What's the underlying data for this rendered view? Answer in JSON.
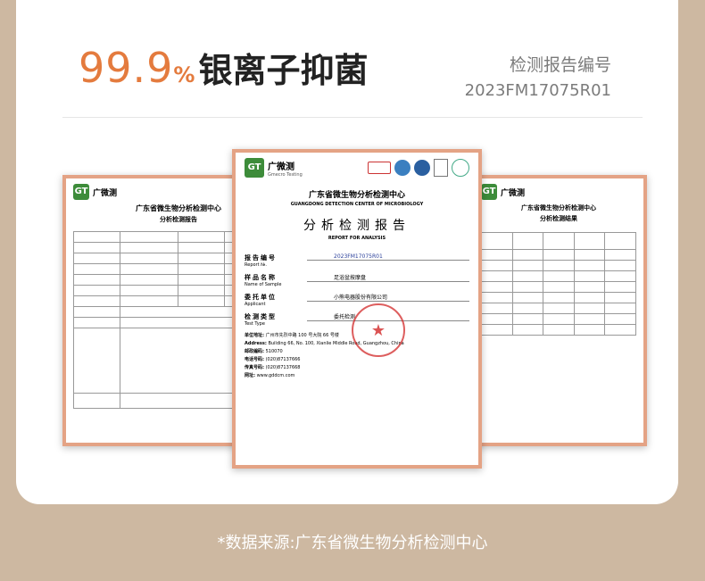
{
  "headline": {
    "number": "99.9",
    "percent": "%",
    "title": "银离子抑菌"
  },
  "report": {
    "label": "检测报告编号",
    "number": "2023FM17075R01"
  },
  "center_doc": {
    "brand": "广微测",
    "brand_en": "Gmecro Testing",
    "org": "广东省微生物分析检测中心",
    "org_en": "GUANGDONG DETECTION CENTER OF MICROBIOLOGY",
    "title": "分析检测报告",
    "title_en": "REPORT FOR ANALYSIS",
    "fields": [
      {
        "label": "报告编号",
        "label_en": "Report №.",
        "value": "2023FM17075R01"
      },
      {
        "label": "样品名称",
        "label_en": "Name of Sample",
        "value": "足浴盆按摩盘"
      },
      {
        "label": "委托单位",
        "label_en": "Applicant",
        "value": "小熊电器股份有限公司"
      },
      {
        "label": "检测类型",
        "label_en": "Test Type",
        "value": "委托检测"
      }
    ],
    "contact": [
      {
        "label": "单位地址:",
        "value": "广州市先烈中路 100 号大院 66 号楼"
      },
      {
        "label": "Address:",
        "value": "Building 66, No. 100, Xianlie Middle Road, Guangzhou, China"
      },
      {
        "label": "邮政编码:",
        "value": "510070"
      },
      {
        "label": "电话号码:",
        "value": "(020)87137666"
      },
      {
        "label": "传真号码:",
        "value": "(020)87137668"
      },
      {
        "label": "网址:",
        "value": "www.gddcm.com"
      }
    ]
  },
  "left_doc": {
    "brand": "广微测",
    "org": "广东省微生物分析检测中心",
    "title": "分析检测报告"
  },
  "right_doc": {
    "brand": "广微测",
    "org": "广东省微生物分析检测中心",
    "title": "分析检测结果"
  },
  "footnote": "*数据来源:广东省微生物分析检测中心"
}
